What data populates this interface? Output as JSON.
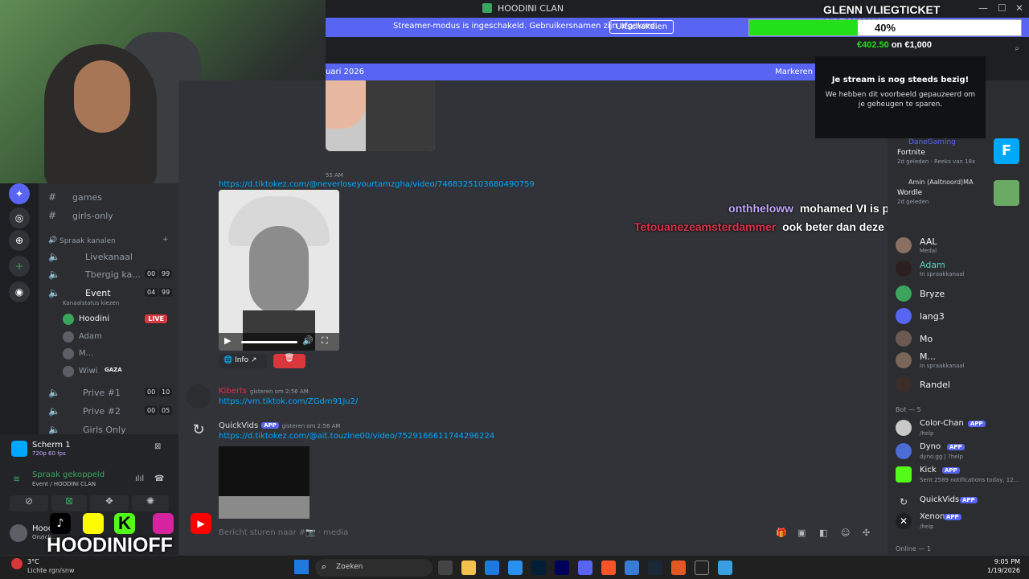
{
  "window": {
    "title": "HOODINI CLAN"
  },
  "overlay": {
    "campaign_title": "GLENN VLIEGTICKET CARNAVAL",
    "progress_percent_text": "40%",
    "progress_fraction": 0.4,
    "progress_raised": "€402.50",
    "progress_goal_text": "on €1,000",
    "brand_name": "HOODINIOFF",
    "accent_green": "#22e01a"
  },
  "banner": {
    "message": "Streamer-modus is ingeschakeld. Gebruikersnamen zijn afgekord.",
    "button": "Uitschakelen",
    "color": "#5865f2"
  },
  "paused_popup": {
    "heading": "Je stream is nog steeds bezig!",
    "body": "We hebben dit voorbeeld gepauzeerd om je geheugen te sparen."
  },
  "date_bar": {
    "left": "uari 2026",
    "right": "Markeren"
  },
  "channels": {
    "text": [
      {
        "name": "games"
      },
      {
        "name": "girls-only"
      }
    ],
    "voice_header": "Spraak kanalen",
    "voice": [
      {
        "name": "Livekanaal",
        "a": "",
        "b": ""
      },
      {
        "name": "Tbergig ka...",
        "a": "00",
        "b": "99"
      },
      {
        "name": "Event",
        "a": "04",
        "b": "99",
        "status": "Kanaalstatus kiezen"
      }
    ],
    "event_users": [
      {
        "name": "Hoodini",
        "badge": "LIVE"
      },
      {
        "name": "Adam",
        "badge": ""
      },
      {
        "name": "M...",
        "badge": ""
      },
      {
        "name": "Wiwi",
        "badge": "GAZA"
      }
    ],
    "voice_more": [
      {
        "name": "Prive #1",
        "a": "00",
        "b": "10"
      },
      {
        "name": "Prive #2",
        "a": "00",
        "b": "05"
      },
      {
        "name": "Girls Only",
        "a": "",
        "b": ""
      }
    ]
  },
  "screen_share": {
    "title": "Scherm 1",
    "quality": "720p 60 fps"
  },
  "voice_status": {
    "title": "Spraak gekoppeld",
    "channel": "Event / HOODINI CLAN"
  },
  "user_panel": {
    "name": "Hooc",
    "status": "Onzich..."
  },
  "messages": [
    {
      "time": "55 AM",
      "link": "https://d.tiktokez.com/@neverloseyourtamzgha/video/7468325103680490759"
    },
    {
      "author": "Kiberts",
      "time": "gisteren om 2:56 AM",
      "link": "https://vm.tiktok.com/ZGdm91Ju2/"
    },
    {
      "author": "QuickVids",
      "app": "APP",
      "time": "gisteren om 2:56 AM",
      "link": "https://d.tiktokez.com/@ait.touzine00/video/7529166611744296224"
    }
  ],
  "embed_buttons": {
    "info": "Info"
  },
  "overlay_chat": [
    {
      "user": "onthheloww",
      "text": "mohamed VI is pas een nietsnut",
      "color": "#c4a8ff"
    },
    {
      "user": "Tetouanezeamsterdammer",
      "text": "ook beter dan deze dayouth koning",
      "color": "#e0334c"
    }
  ],
  "composer": {
    "placeholder": "Bericht sturen naar #📷 · media"
  },
  "activity": [
    {
      "user": "DaneGaming",
      "game": "Fortnite",
      "meta": "2d geleden · Reeks van 18x"
    },
    {
      "user": "Amin (Aaltnoord)MA",
      "game": "Wordle",
      "meta": "2d geleden"
    }
  ],
  "members": [
    {
      "name": "AAL",
      "status": "Medal",
      "color": "#f2f3f5"
    },
    {
      "name": "Adam",
      "status": "In spraakkanaal",
      "color": "#5ad5c0"
    },
    {
      "name": "Bryze",
      "status": "",
      "color": "#f2f3f5"
    },
    {
      "name": "lang3",
      "status": "",
      "color": "#f2f3f5"
    },
    {
      "name": "Mo",
      "status": "",
      "color": "#f2f3f5"
    },
    {
      "name": "M...",
      "status": "In spraakkanaal",
      "color": "#f2f3f5"
    },
    {
      "name": "Randel",
      "status": "",
      "color": "#f2f3f5"
    }
  ],
  "bot_header": "Bot — 5",
  "bots": [
    {
      "name": "Color-Chan",
      "app": "APP",
      "status": "/help"
    },
    {
      "name": "Dyno",
      "app": "APP",
      "status": "dyno.gg | ?help"
    },
    {
      "name": "Kick",
      "app": "APP",
      "status": "Sent 2589 notifications today, 12..."
    },
    {
      "name": "QuickVids",
      "app": "APP",
      "status": "/help"
    },
    {
      "name": "Xenon",
      "app": "APP",
      "status": "/help"
    }
  ],
  "online_header": "Online — 1",
  "taskbar": {
    "weather_temp": "3°C",
    "weather_text": "Lichte rgn/snw",
    "search": "Zoeken",
    "time": "9:05 PM",
    "date": "1/19/2026"
  }
}
